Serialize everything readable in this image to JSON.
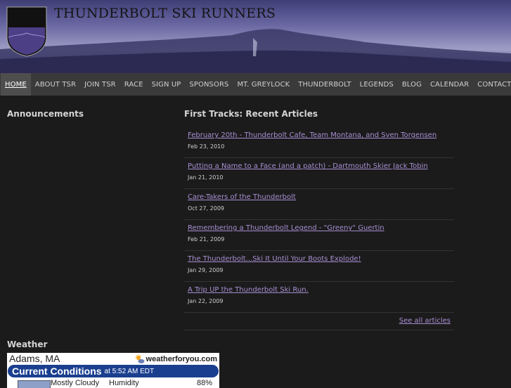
{
  "header": {
    "site_title": "THUNDERBOLT SKI RUNNERS",
    "logo_text": "THUNDERBOLT SKI RUNNERS"
  },
  "nav": {
    "items": [
      {
        "label": "HOME",
        "active": true
      },
      {
        "label": "ABOUT TSR"
      },
      {
        "label": "JOIN TSR"
      },
      {
        "label": "RACE"
      },
      {
        "label": "SIGN UP"
      },
      {
        "label": "SPONSORS"
      },
      {
        "label": "MT. GREYLOCK"
      },
      {
        "label": "THUNDERBOLT"
      },
      {
        "label": "LEGENDS"
      },
      {
        "label": "BLOG"
      },
      {
        "label": "CALENDAR"
      },
      {
        "label": "CONTACT"
      }
    ]
  },
  "announcements": {
    "heading": "Announcements"
  },
  "articles": {
    "heading": "First Tracks: Recent Articles",
    "items": [
      {
        "title": "February 20th - Thunderbolt Cafe, Team Montana, and Sven Torgensen",
        "date": "Feb 23, 2010"
      },
      {
        "title": "Putting a Name to a Face (and a patch) - Dartmouth Skier Jack Tobin",
        "date": "Jan 21, 2010"
      },
      {
        "title": "Care-Takers of the Thunderbolt",
        "date": "Oct 27, 2009"
      },
      {
        "title": "Remembering a Thunderbolt Legend - \"Greeny\" Guertin",
        "date": "Feb 21, 2009"
      },
      {
        "title": "The Thunderbolt...Ski It Until Your Boots Explode!",
        "date": "Jan 29, 2009"
      },
      {
        "title": "A Trip UP the Thunderbolt Ski Run.",
        "date": "Jan 22, 2009"
      }
    ],
    "see_all": "See all articles"
  },
  "weather": {
    "heading": "Weather",
    "location": "Adams, MA",
    "brand": "weatherforyou.com",
    "current_label": "Current Conditions",
    "time_text": "at 5:52 AM EDT",
    "condition": "Mostly Cloudy",
    "humidity_label": "Humidity",
    "humidity_value": "88%"
  },
  "colors": {
    "accent_link": "#a88fd3",
    "nav_bg": "#3a3a3a",
    "page_bg": "#1b1b1b",
    "weather_bar": "#1b3f8f"
  }
}
